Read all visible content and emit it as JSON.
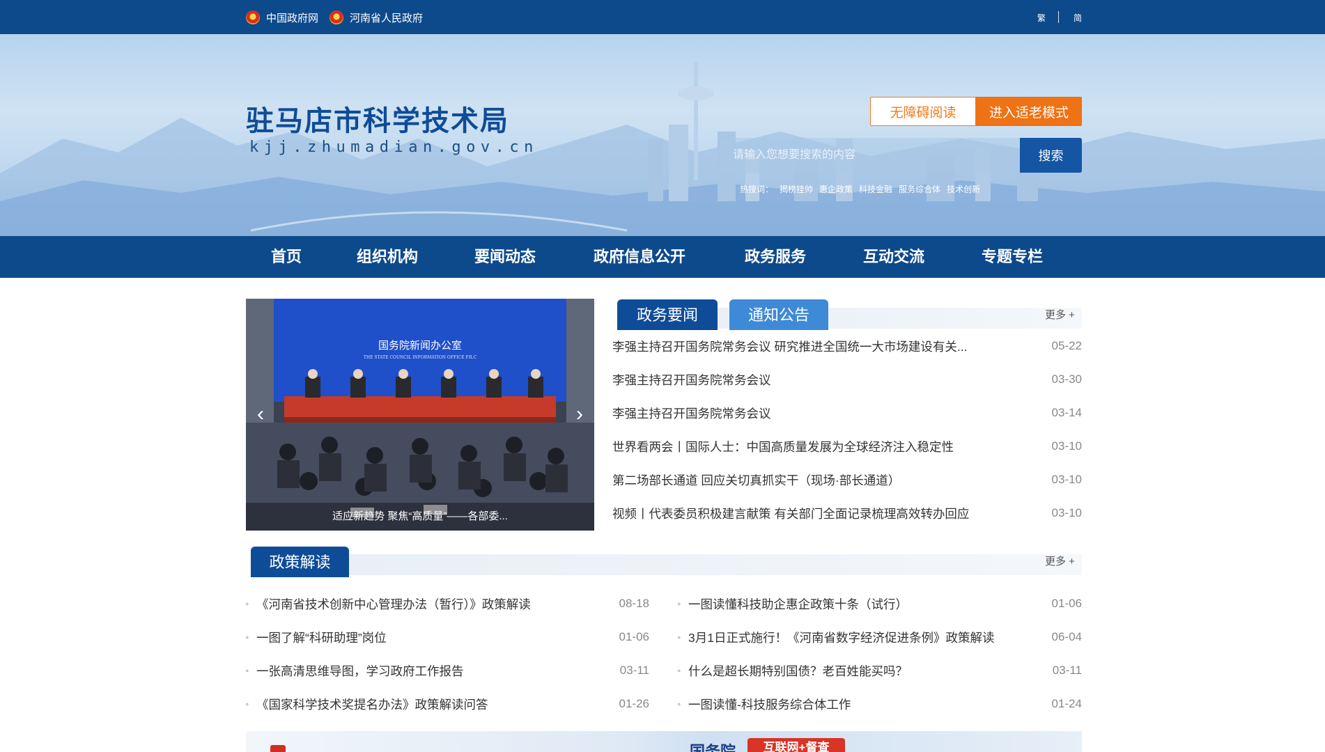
{
  "topbar": {
    "links": [
      {
        "label": "中国政府网",
        "icon": "national-emblem-icon"
      },
      {
        "label": "河南省人民政府",
        "icon": "national-emblem-icon"
      }
    ],
    "lang_traditional": "繁",
    "lang_simplified": "简"
  },
  "header": {
    "title": "驻马店市科学技术局",
    "domain": "kjj.zhumadian.gov.cn",
    "accessible_label": "无障碍阅读",
    "elder_label": "进入适老模式",
    "search_placeholder": "请输入您想要搜索的内容",
    "search_label": "搜索",
    "hotwords_label": "热搜词：",
    "hotwords": [
      "揭榜挂帅",
      "惠企政策",
      "科技金融",
      "服务综合体",
      "技术创新"
    ]
  },
  "nav": {
    "items": [
      "首页",
      "组织机构",
      "要闻动态",
      "政府信息公开",
      "政务服务",
      "互动交流",
      "专题专栏"
    ]
  },
  "slider": {
    "caption": "适应新趋势 聚焦“高质量”——各部委...",
    "backdrop_title": "国务院新闻办公室",
    "backdrop_subtitle": "THE STATE COUNCIL INFORMATION OFFICE P.R.C",
    "prev_icon": "chevron-left-icon",
    "next_icon": "chevron-right-icon"
  },
  "news": {
    "tabs": [
      "政务要闻",
      "通知公告"
    ],
    "active_tab": 0,
    "more_label": "更多 +",
    "items": [
      {
        "title": "李强主持召开国务院常务会议 研究推进全国统一大市场建设有关...",
        "date": "05-22"
      },
      {
        "title": "李强主持召开国务院常务会议",
        "date": "03-30"
      },
      {
        "title": "李强主持召开国务院常务会议",
        "date": "03-14"
      },
      {
        "title": "世界看两会丨国际人士：中国高质量发展为全球经济注入稳定性",
        "date": "03-10"
      },
      {
        "title": "第二场部长通道 回应关切真抓实干（现场·部长通道）",
        "date": "03-10"
      },
      {
        "title": "视频丨代表委员积极建言献策 有关部门全面记录梳理高效转办回应",
        "date": "03-10"
      }
    ]
  },
  "policy": {
    "title": "政策解读",
    "more_label": "更多 +",
    "left": [
      {
        "title": "《河南省技术创新中心管理办法（暂行）》政策解读",
        "date": "08-18"
      },
      {
        "title": "一图了解“科研助理”岗位",
        "date": "01-06"
      },
      {
        "title": "一张高清思维导图，学习政府工作报告",
        "date": "03-11"
      },
      {
        "title": "《国家科学技术奖提名办法》政策解读问答",
        "date": "01-26"
      }
    ],
    "right": [
      {
        "title": "一图读懂科技助企惠企政策十条（试行）",
        "date": "01-06"
      },
      {
        "title": "3月1日正式施行！《河南省数字经济促进条例》政策解读",
        "date": "06-04"
      },
      {
        "title": "什么是超长期特别国债？老百姓能买吗？",
        "date": "03-11"
      },
      {
        "title": "一图读懂-科技服务综合体工作",
        "date": "01-24"
      }
    ]
  },
  "bottom_banner": {
    "text": "国务院",
    "badge": "互联网+督查"
  },
  "colors": {
    "primary_blue": "#0d4a8c",
    "tab_active": "#0f4c97",
    "tab_inactive": "#3e8ad6",
    "accent_orange": "#ef7215"
  }
}
